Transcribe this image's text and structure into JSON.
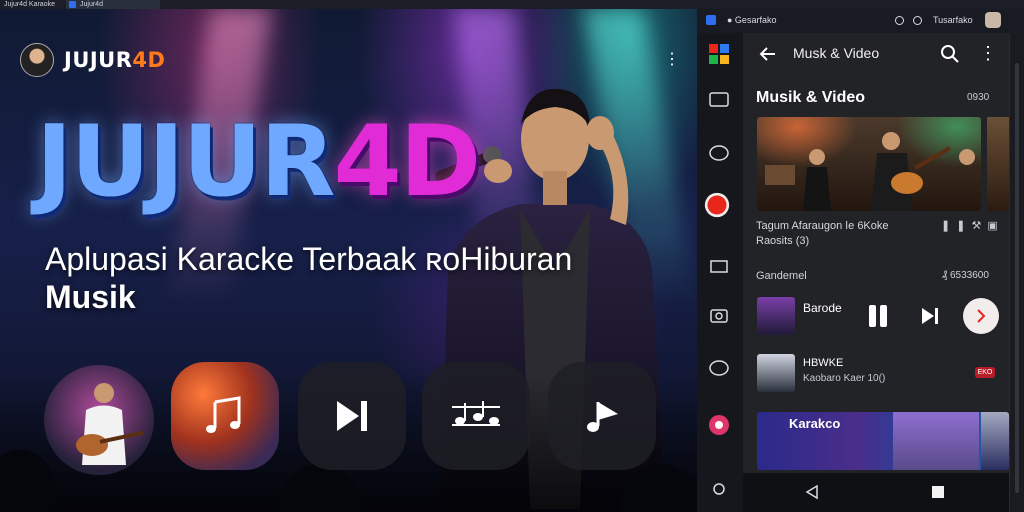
{
  "browser": {
    "tabs": [
      {
        "label": "Jujur4d Karaoke"
      },
      {
        "label": "Jujur4d"
      }
    ]
  },
  "hero": {
    "brand": {
      "name_main": "JUJUR",
      "name_accent": "4D"
    },
    "logo": {
      "main": "JUJUR",
      "accent": "4D"
    },
    "tagline": {
      "line1": "Aplupasi Karacke Terbaak ʀoHiburan",
      "line2": "Musik"
    },
    "tiles": [
      {
        "icon": "guitarist-photo-icon"
      },
      {
        "icon": "music-notes-icon"
      },
      {
        "icon": "skip-next-icon"
      },
      {
        "icon": "music-sheet-icon"
      },
      {
        "icon": "music-note-icon"
      }
    ]
  },
  "phone": {
    "status": {
      "app_label": "● Gesarfako",
      "time": "Tusarfako"
    },
    "appbar": {
      "title": "Musk & Video"
    },
    "section": {
      "title": "Musik & Video",
      "count": "0930"
    },
    "card": {
      "caption_line1": "Tagum Afaraugon ǀe 6Koke",
      "caption_line2": "Raosits (3)"
    },
    "divider": {
      "left": "Gandemel",
      "right": "₰ 6533600"
    },
    "now_playing": {
      "title": "Barode"
    },
    "track": {
      "title": "HBWKE",
      "subtitle": "Kaobaro Kaer 10()",
      "badge": "EKO"
    },
    "strip": {
      "label": "Karakco"
    },
    "colors": {
      "accent_red": "#e8261c",
      "fab": "#f3ecec",
      "logo_blue": "#6fa9ff",
      "logo_pink": "#e02bd6",
      "brand_orange": "#ff7a1a"
    }
  }
}
